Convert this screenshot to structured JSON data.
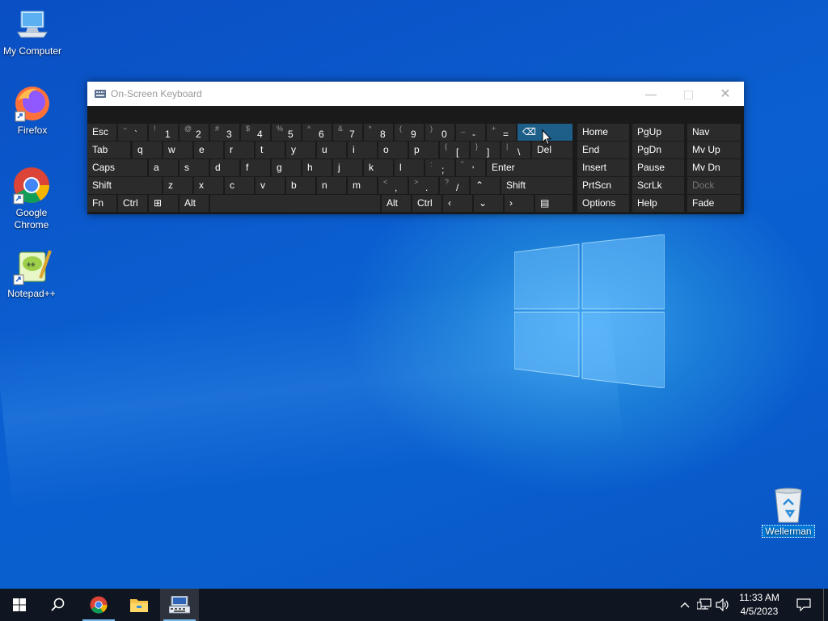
{
  "desktop": {
    "icons": [
      {
        "label": "My Computer"
      },
      {
        "label": "Firefox"
      },
      {
        "label": "Google Chrome"
      },
      {
        "label": "Notepad++"
      }
    ],
    "recycle_bin": {
      "label": "Wellerman"
    }
  },
  "osk": {
    "title": "On-Screen Keyboard",
    "rows": [
      [
        {
          "label": "Esc"
        },
        {
          "shift": "~",
          "main": "`"
        },
        {
          "shift": "!",
          "main": "1"
        },
        {
          "shift": "@",
          "main": "2"
        },
        {
          "shift": "#",
          "main": "3"
        },
        {
          "shift": "$",
          "main": "4"
        },
        {
          "shift": "%",
          "main": "5"
        },
        {
          "shift": "^",
          "main": "6"
        },
        {
          "shift": "&",
          "main": "7"
        },
        {
          "shift": "*",
          "main": "8"
        },
        {
          "shift": "(",
          "main": "9"
        },
        {
          "shift": ")",
          "main": "0"
        },
        {
          "shift": "_",
          "main": "-"
        },
        {
          "shift": "+",
          "main": "="
        },
        {
          "label": "⌫"
        }
      ],
      [
        {
          "label": "Tab"
        },
        {
          "label": "q"
        },
        {
          "label": "w"
        },
        {
          "label": "e"
        },
        {
          "label": "r"
        },
        {
          "label": "t"
        },
        {
          "label": "y"
        },
        {
          "label": "u"
        },
        {
          "label": "i"
        },
        {
          "label": "o"
        },
        {
          "label": "p"
        },
        {
          "shift": "{",
          "main": "["
        },
        {
          "shift": "}",
          "main": "]"
        },
        {
          "shift": "|",
          "main": "\\"
        },
        {
          "label": "Del"
        }
      ],
      [
        {
          "label": "Caps"
        },
        {
          "label": "a"
        },
        {
          "label": "s"
        },
        {
          "label": "d"
        },
        {
          "label": "f"
        },
        {
          "label": "g"
        },
        {
          "label": "h"
        },
        {
          "label": "j"
        },
        {
          "label": "k"
        },
        {
          "label": "l"
        },
        {
          "shift": ":",
          "main": ";"
        },
        {
          "shift": "\"",
          "main": "'"
        },
        {
          "label": "Enter"
        }
      ],
      [
        {
          "label": "Shift"
        },
        {
          "label": "z"
        },
        {
          "label": "x"
        },
        {
          "label": "c"
        },
        {
          "label": "v"
        },
        {
          "label": "b"
        },
        {
          "label": "n"
        },
        {
          "label": "m"
        },
        {
          "shift": "<",
          "main": ","
        },
        {
          "shift": ">",
          "main": "."
        },
        {
          "shift": "?",
          "main": "/"
        },
        {
          "label": "⌃"
        },
        {
          "label": "Shift"
        }
      ],
      [
        {
          "label": "Fn"
        },
        {
          "label": "Ctrl"
        },
        {
          "label": "⊞"
        },
        {
          "label": "Alt"
        },
        {
          "label": ""
        },
        {
          "label": "Alt"
        },
        {
          "label": "Ctrl"
        },
        {
          "label": "‹"
        },
        {
          "label": "⌄"
        },
        {
          "label": "›"
        },
        {
          "label": "▤"
        }
      ]
    ],
    "nav": [
      [
        "Home",
        "PgUp",
        "Nav"
      ],
      [
        "End",
        "PgDn",
        "Mv Up"
      ],
      [
        "Insert",
        "Pause",
        "Mv Dn"
      ],
      [
        "PrtScn",
        "ScrLk",
        "Dock"
      ],
      [
        "Options",
        "Help",
        "Fade"
      ]
    ]
  },
  "taskbar": {
    "time": "11:33 AM",
    "date": "4/5/2023",
    "icons": [
      "windows-start-icon",
      "search-icon",
      "chrome-icon",
      "file-explorer-icon",
      "on-screen-keyboard-icon"
    ]
  }
}
